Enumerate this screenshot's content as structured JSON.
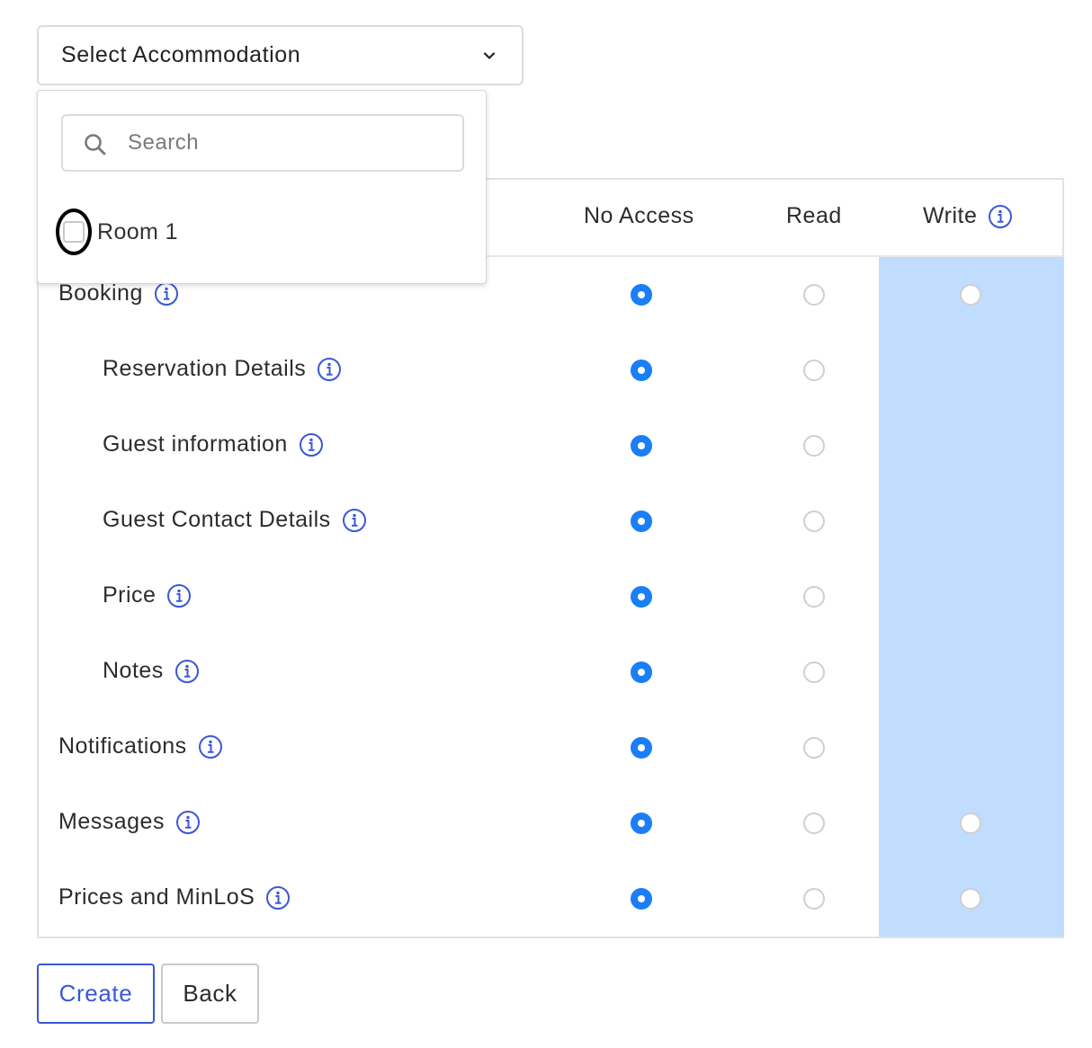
{
  "select": {
    "label": "Select Accommodation",
    "icon": "chevron-down-icon"
  },
  "dropdown": {
    "search": {
      "placeholder": "Search",
      "value": "",
      "icon": "search-icon"
    },
    "options": [
      {
        "label": "Room 1",
        "checked": false
      }
    ]
  },
  "table": {
    "columns": {
      "no_access": "No Access",
      "read": "Read",
      "write": "Write"
    },
    "rows": [
      {
        "label": "Booking",
        "indent": false,
        "selected": "no_access",
        "write_available": true
      },
      {
        "label": "Reservation Details",
        "indent": true,
        "selected": "no_access",
        "write_available": false
      },
      {
        "label": "Guest information",
        "indent": true,
        "selected": "no_access",
        "write_available": false
      },
      {
        "label": "Guest Contact Details",
        "indent": true,
        "selected": "no_access",
        "write_available": false
      },
      {
        "label": "Price",
        "indent": true,
        "selected": "no_access",
        "write_available": false
      },
      {
        "label": "Notes",
        "indent": true,
        "selected": "no_access",
        "write_available": false
      },
      {
        "label": "Notifications",
        "indent": false,
        "selected": "no_access",
        "write_available": false
      },
      {
        "label": "Messages",
        "indent": false,
        "selected": "no_access",
        "write_available": true
      },
      {
        "label": "Prices and MinLoS",
        "indent": false,
        "selected": "no_access",
        "write_available": true
      }
    ]
  },
  "buttons": {
    "create": "Create",
    "back": "Back"
  },
  "colors": {
    "accent": "#3a57d9",
    "radio_selected": "#1a7ef6",
    "write_column_bg": "#c0dcff"
  }
}
